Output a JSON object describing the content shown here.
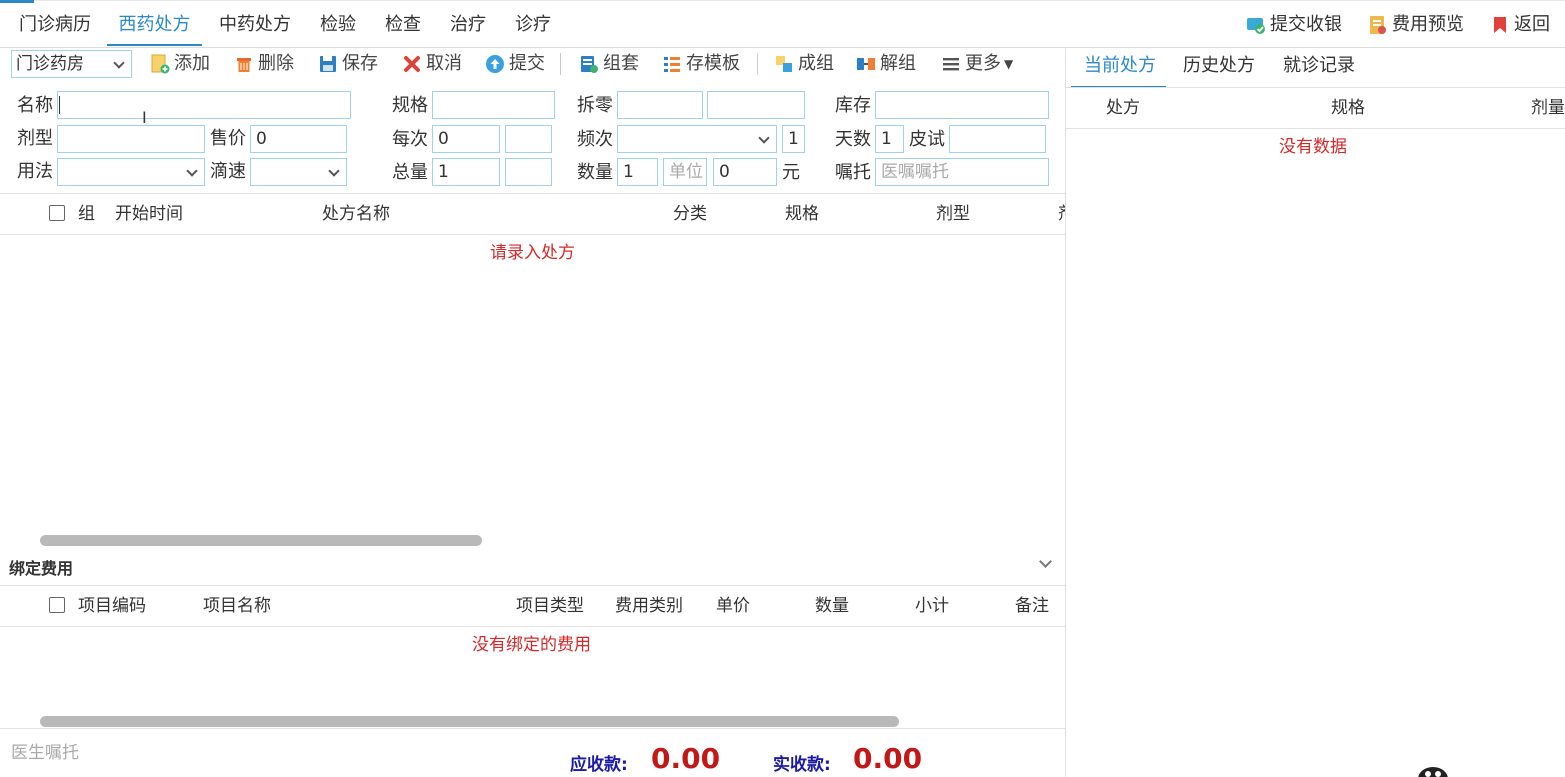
{
  "top_tabs": [
    "门诊病历",
    "西药处方",
    "中药处方",
    "检验",
    "检查",
    "治疗",
    "诊疗"
  ],
  "top_actions": {
    "submit_cashier": "提交收银",
    "fee_preview": "费用预览",
    "back": "返回"
  },
  "toolbar": {
    "pharmacy": "门诊药房",
    "add": "添加",
    "delete": "删除",
    "save": "保存",
    "cancel": "取消",
    "submit": "提交",
    "group_set": "组套",
    "save_template": "存模板",
    "make_group": "成组",
    "ungroup": "解组",
    "more": "更多"
  },
  "form": {
    "name_label": "名称",
    "name_value": "",
    "spec_label": "规格",
    "spec_value": "",
    "split_label": "拆零",
    "split_value1": "",
    "split_value2": "",
    "stock_label": "库存",
    "stock_value": "",
    "dosage_form_label": "剂型",
    "dosage_form_value": "",
    "price_label": "售价",
    "price_value": "0",
    "per_dose_label": "每次",
    "per_dose_value": "0",
    "per_dose_unit": "",
    "frequency_label": "频次",
    "frequency_value": "",
    "frequency_count": "1",
    "days_label": "天数",
    "days_value": "1",
    "skin_test_label": "皮试",
    "skin_test_value": "",
    "usage_label": "用法",
    "usage_value": "",
    "drip_rate_label": "滴速",
    "drip_rate_value": "",
    "total_label": "总量",
    "total_value": "1",
    "total_unit": "",
    "quantity_label": "数量",
    "quantity_value": "1",
    "unit_placeholder": "单位",
    "amount_value": "0",
    "yuan": "元",
    "advice_label": "嘱托",
    "advice_placeholder": "医嘱嘱托"
  },
  "rx_table": {
    "headers": [
      "组",
      "开始时间",
      "处方名称",
      "分类",
      "规格",
      "剂型",
      "剂"
    ],
    "empty_text": "请录入处方"
  },
  "fee_section": {
    "title": "绑定费用",
    "headers": [
      "项目编码",
      "项目名称",
      "项目类型",
      "费用类别",
      "单价",
      "数量",
      "小计",
      "备注"
    ],
    "empty_text": "没有绑定的费用"
  },
  "right_panel": {
    "tabs": [
      "当前处方",
      "历史处方",
      "就诊记录"
    ],
    "headers": [
      "处方",
      "规格",
      "剂量"
    ],
    "empty_text": "没有数据"
  },
  "footer": {
    "doctor_advice_placeholder": "医生嘱托",
    "receivable_label": "应收款:",
    "receivable_value": "0.00",
    "received_label": "实收款:",
    "received_value": "0.00"
  },
  "colors": {
    "accent": "#2b89c9",
    "empty_text": "#d62828",
    "sum_label": "#1a1aa8",
    "sum_value": "#c21818"
  }
}
